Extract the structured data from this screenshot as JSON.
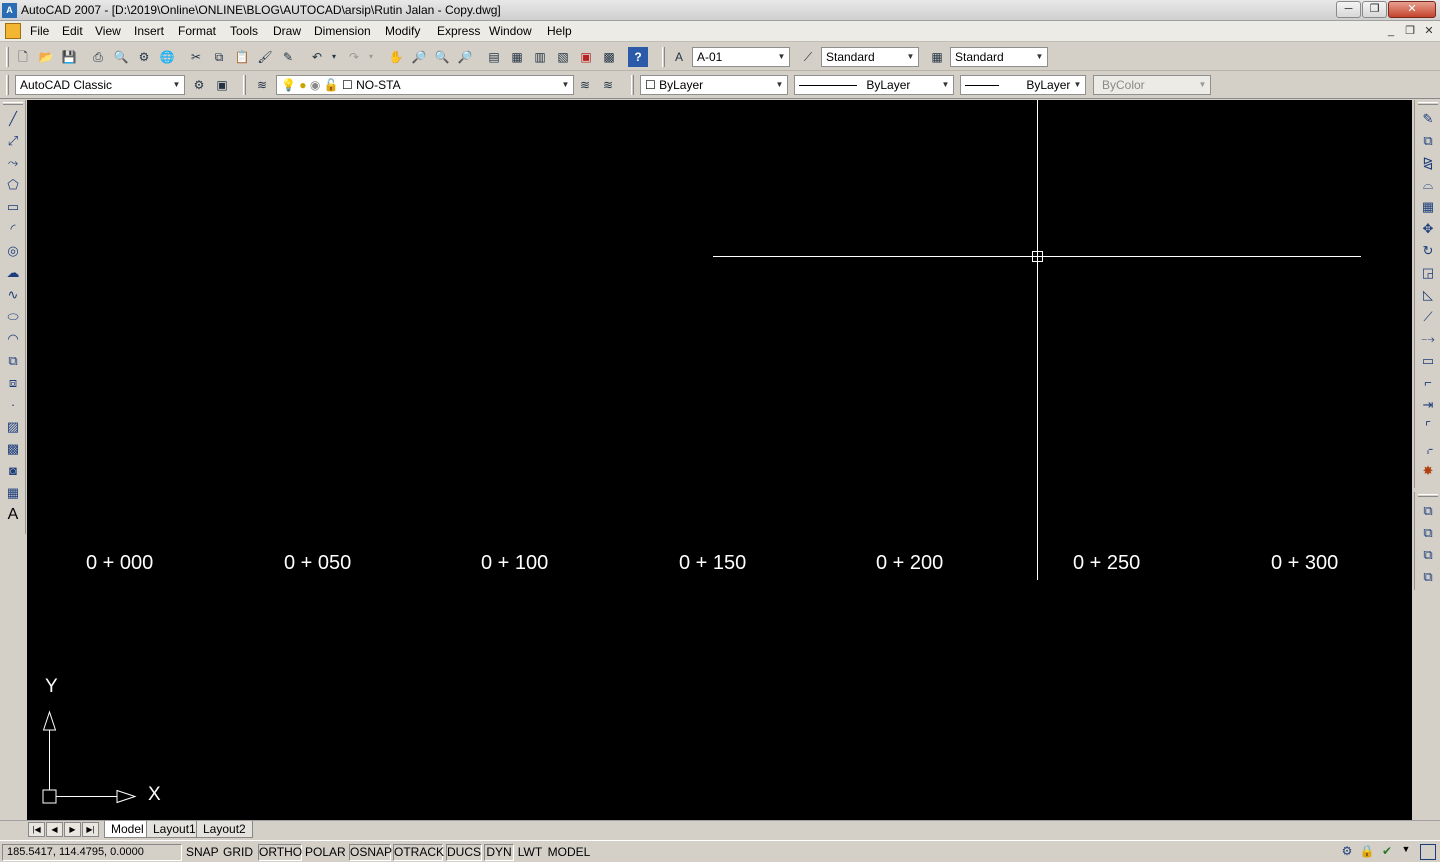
{
  "window": {
    "app_logo": "A",
    "title": "AutoCAD 2007 - [D:\\2019\\Online\\ONLINE\\BLOG\\AUTOCAD\\arsip\\Rutin Jalan - Copy.dwg]",
    "minimize": "─",
    "restore": "❐",
    "close": "✕"
  },
  "menu": {
    "items": [
      "File",
      "Edit",
      "View",
      "Insert",
      "Format",
      "Tools",
      "Draw",
      "Dimension",
      "Modify",
      "Express",
      "Window",
      "Help"
    ],
    "doc_minimize": "_",
    "doc_restore": "❐",
    "doc_close": "✕"
  },
  "standard_toolbar": {
    "text_style": "A-01",
    "dim_style": "Standard",
    "table_style": "Standard"
  },
  "workspace_toolbar": {
    "workspace": "AutoCAD Classic",
    "layer": "NO-STA",
    "color": "ByLayer",
    "linetype": "ByLayer",
    "lineweight": "ByLayer",
    "plot_style": "ByColor"
  },
  "canvas": {
    "background": "#000000",
    "stations": [
      "0 + 000",
      "0 + 050",
      "0 + 100",
      "0 + 150",
      "0 + 200",
      "0 + 250",
      "0 + 300"
    ],
    "ucs_x": "X",
    "ucs_y": "Y"
  },
  "tabs": {
    "items": [
      "Model",
      "Layout1",
      "Layout2"
    ],
    "active": "Model"
  },
  "status": {
    "coordinates": "185.5417, 114.4795, 0.0000",
    "toggles": [
      "SNAP",
      "GRID",
      "ORTHO",
      "POLAR",
      "OSNAP",
      "OTRACK",
      "DUCS",
      "DYN",
      "LWT",
      "MODEL"
    ]
  },
  "icons": {
    "left_draw": [
      "line-icon",
      "construction-line-icon",
      "polyline-icon",
      "polygon-icon",
      "rectangle-icon",
      "arc-icon",
      "circle-icon",
      "revision-cloud-icon",
      "spline-icon",
      "ellipse-icon",
      "ellipse-arc-icon",
      "insert-block-icon",
      "make-block-icon",
      "point-icon",
      "hatch-icon",
      "gradient-icon",
      "region-icon",
      "table-icon",
      "multiline-text-icon"
    ],
    "right_modify": [
      "erase-icon",
      "copy-icon",
      "mirror-icon",
      "offset-icon",
      "array-icon",
      "move-icon",
      "rotate-icon",
      "scale-icon",
      "stretch-icon",
      "trim-icon",
      "extend-icon",
      "break-at-point-icon",
      "break-icon",
      "join-icon",
      "chamfer-icon",
      "fillet-icon",
      "explode-icon"
    ],
    "right_draworder": [
      "bring-to-front-icon",
      "send-to-back-icon",
      "bring-above-icon",
      "send-under-icon"
    ]
  }
}
